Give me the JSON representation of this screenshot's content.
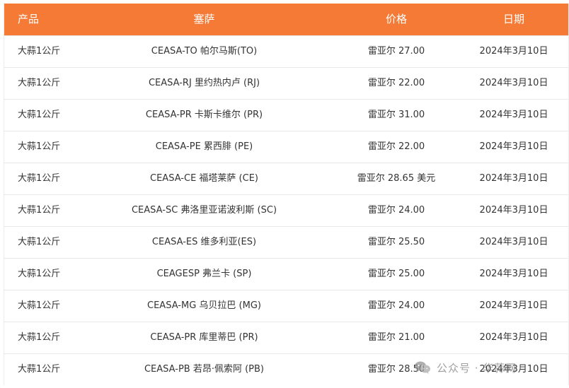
{
  "table": {
    "headers": [
      "产品",
      "塞萨",
      "价格",
      "日期"
    ],
    "rows": [
      [
        "大蒜1公斤",
        "CEASA-TO 帕尔马斯(TO)",
        "雷亚尔 27.00",
        "2024年3月10日"
      ],
      [
        "大蒜1公斤",
        "CEASA-RJ 里约热内卢 (RJ)",
        "雷亚尔 22.00",
        "2024年3月10日"
      ],
      [
        "大蒜1公斤",
        "CEASA-PR 卡斯卡维尔 (PR)",
        "雷亚尔 31.00",
        "2024年3月10日"
      ],
      [
        "大蒜1公斤",
        "CEASA-PE 累西腓 (PE)",
        "雷亚尔 22.00",
        "2024年3月10日"
      ],
      [
        "大蒜1公斤",
        "CEASA-CE 福塔莱萨 (CE)",
        "雷亚尔 28.65 美元",
        "2024年3月10日"
      ],
      [
        "大蒜1公斤",
        "CEASA-SC 弗洛里亚诺波利斯 (SC)",
        "雷亚尔 24.00",
        "2024年3月10日"
      ],
      [
        "大蒜1公斤",
        "CEASA-ES 维多利亚(ES)",
        "雷亚尔 25.50",
        "2024年3月10日"
      ],
      [
        "大蒜1公斤",
        "CEAGESP 弗兰卡 (SP)",
        "雷亚尔 25.00",
        "2024年3月10日"
      ],
      [
        "大蒜1公斤",
        "CEASA-MG 乌贝拉巴 (MG)",
        "雷亚尔 24.00",
        "2024年3月10日"
      ],
      [
        "大蒜1公斤",
        "CEASA-PR 库里蒂巴 (PR)",
        "雷亚尔 21.00",
        "2024年3月10日"
      ],
      [
        "大蒜1公斤",
        "CEASA-PB 若昂·佩索阿 (PB)",
        "雷亚尔 28.50",
        "2024年3月10日"
      ]
    ]
  },
  "watermark": {
    "text": "公众号 · 华蒜网",
    "icon": "wechat-icon"
  },
  "colors": {
    "header_bg": "#f47a35",
    "header_text": "#ffffff",
    "row_border": "#e8e8e8",
    "cell_text": "#333333"
  }
}
